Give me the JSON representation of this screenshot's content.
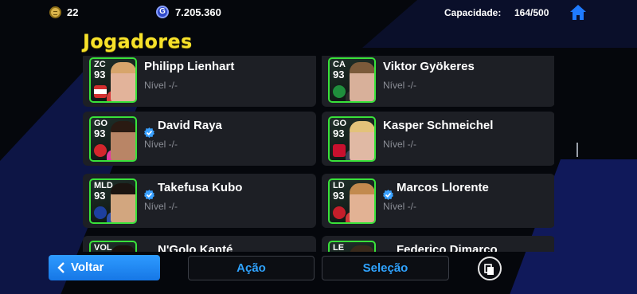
{
  "topbar": {
    "coins": "22",
    "gp": "7.205.360",
    "gp_glyph": "G",
    "capacity_label": "Capacidade:",
    "capacity_value": "164/500",
    "home_icon": "home-icon",
    "accent_color": "#1f7bff"
  },
  "title": "Jogadores",
  "title_color": "#f7e12a",
  "players": [
    {
      "pos": "ZC",
      "ovr": "93",
      "name": "Philipp Lienhart",
      "level": "Nível -/-",
      "verified": false
    },
    {
      "pos": "CA",
      "ovr": "93",
      "name": "Viktor Gyökeres",
      "level": "Nível -/-",
      "verified": false
    },
    {
      "pos": "GO",
      "ovr": "93",
      "name": "David Raya",
      "level": "Nível -/-",
      "verified": true
    },
    {
      "pos": "GO",
      "ovr": "93",
      "name": "Kasper Schmeichel",
      "level": "Nível -/-",
      "verified": false
    },
    {
      "pos": "MLD",
      "ovr": "93",
      "name": "Takefusa Kubo",
      "level": "Nível -/-",
      "verified": true
    },
    {
      "pos": "LD",
      "ovr": "93",
      "name": "Marcos Llorente",
      "level": "Nível -/-",
      "verified": true
    },
    {
      "pos": "VOL",
      "ovr": "",
      "name": "N'Golo Kanté",
      "level": "",
      "verified": true
    },
    {
      "pos": "LE",
      "ovr": "",
      "name": "Federico Dimarco",
      "level": "",
      "verified": true
    }
  ],
  "card_border_color": "#39e23a",
  "footer": {
    "back_label": "Voltar",
    "action_label": "Ação",
    "selection_label": "Seleção",
    "copy_icon": "copy-icon"
  }
}
